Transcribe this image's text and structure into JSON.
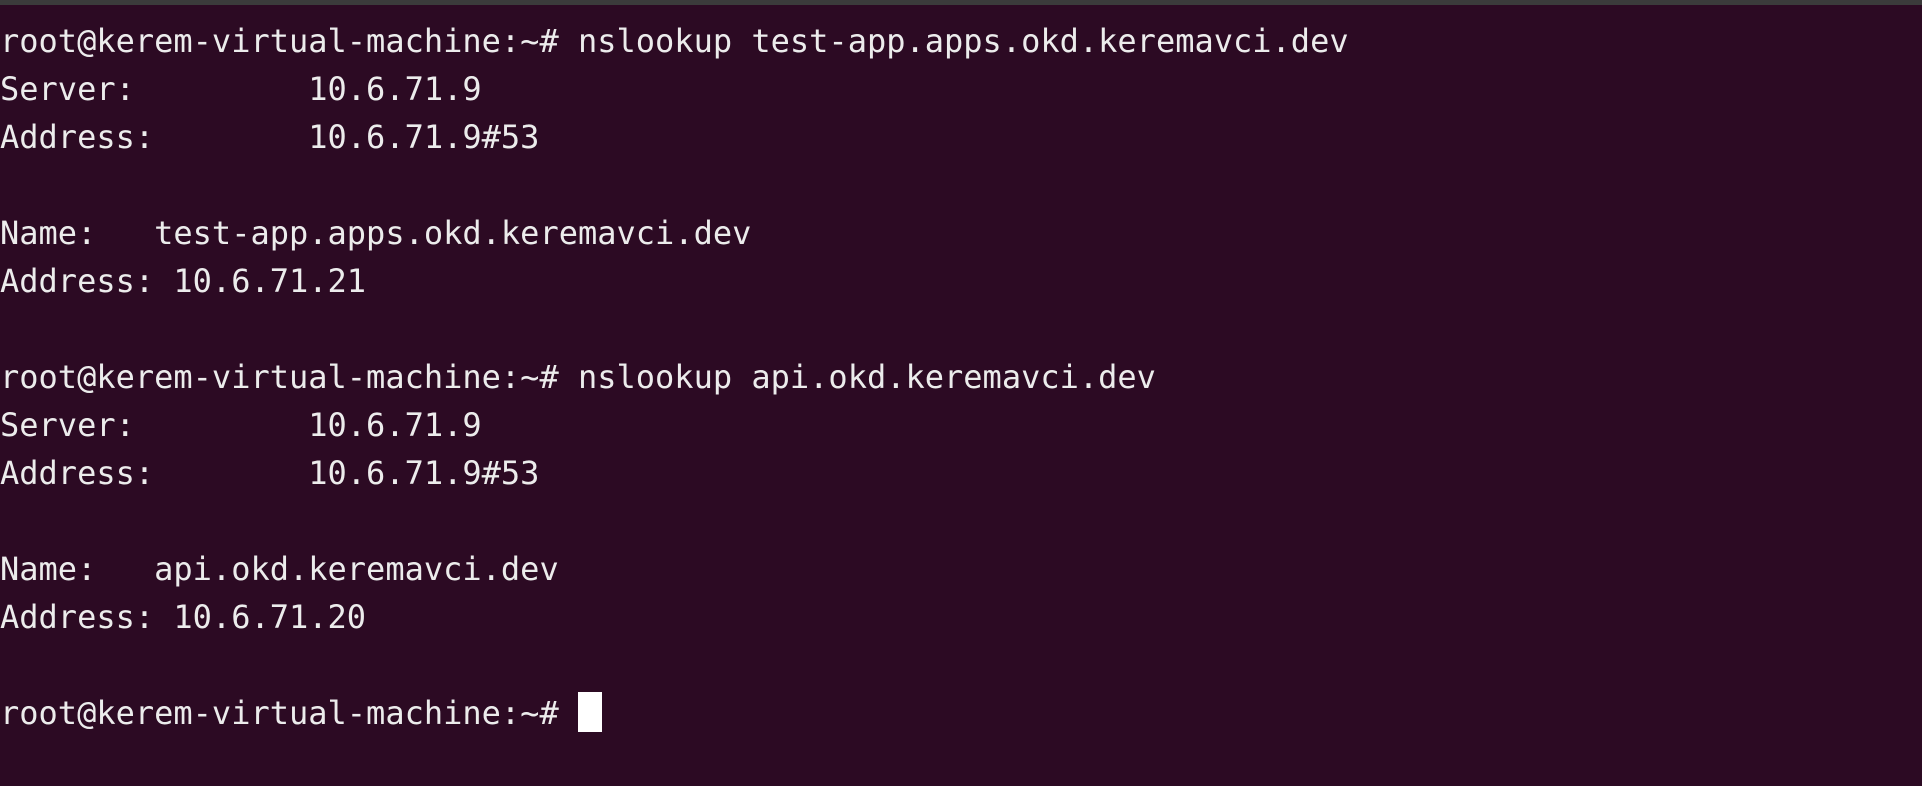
{
  "terminal": {
    "colors": {
      "background": "#2c0a23",
      "text": "#ececec",
      "titlebar": "#3b3b3b",
      "cursor": "#ffffff"
    },
    "lines": [
      "root@kerem-virtual-machine:~# nslookup test-app.apps.okd.keremavci.dev",
      "Server:         10.6.71.9",
      "Address:        10.6.71.9#53",
      "",
      "Name:   test-app.apps.okd.keremavci.dev",
      "Address: 10.6.71.21",
      "",
      "root@kerem-virtual-machine:~# nslookup api.okd.keremavci.dev",
      "Server:         10.6.71.9",
      "Address:        10.6.71.9#53",
      "",
      "Name:   api.okd.keremavci.dev",
      "Address: 10.6.71.20",
      ""
    ],
    "prompt": "root@kerem-virtual-machine:~# "
  }
}
